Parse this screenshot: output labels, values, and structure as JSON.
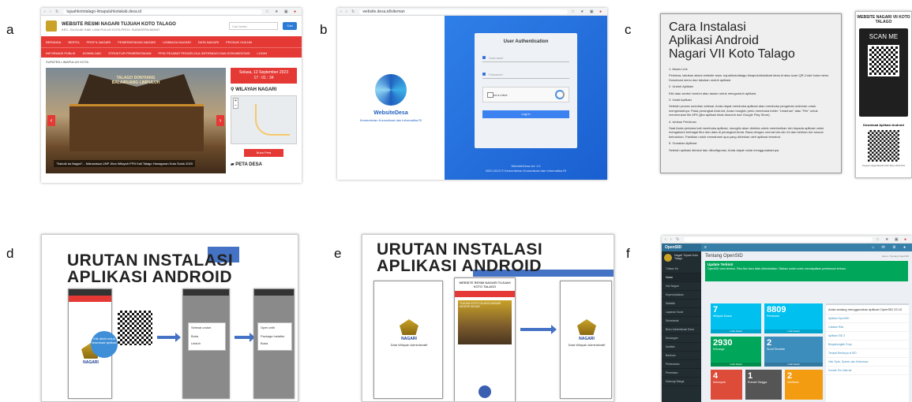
{
  "labels": {
    "a": "a",
    "b": "b",
    "c": "c",
    "d": "d",
    "e": "e",
    "f": "f"
  },
  "panel_a": {
    "url": "tujuahkototalago-limapuluhkotakab.desa.id",
    "site_title": "WEBSITE RESMI NAGARI TUJUAH KOTO TALAGO",
    "site_sub": "KEC. GUGUAK KAB. LIMA PULUH KOTA PROV. SUMATERA BARAT",
    "search_placeholder": "Cari berita",
    "search_button": "Cari",
    "nav1": [
      "BERANDA",
      "BERITA",
      "PROFIL NAGARI",
      "PEMERINTAHAN NAGARI",
      "LEMBAGA NAGARI",
      "DATA NAGARI",
      "PRODUK HUKUM"
    ],
    "nav2": [
      "INFORMASI PUBLIK",
      "DOWNLOAD",
      "STRUKTUR PEMERINTAHAN",
      "PPID PEJABAT PENGELOLA INFORMASI DAN DOKUMENTASI",
      "LOGIN"
    ],
    "breadcrumb": "SUPATEN LIMAPULUH KOTA",
    "photo_sign": "TALAGO DONYIANG BALAIRUANG LIMPULUH",
    "caption": "\"Sabuik ka Nagari\"... Mahasiswa UNP Jilna Wilayah PFN Kali Talago Hanagaran Kota Solok 2020",
    "date": "Selasa, 12 September 2023",
    "time": "17 : 01 : 34",
    "wilayah": "WILAYAH NAGARI",
    "buka_peta": "Buka Peta",
    "peta_desa": "PETA DESA"
  },
  "panel_b": {
    "url": "website.desa.id/siteman",
    "brand": "WebsiteDesa",
    "ministry": "Kementerian Komunikasi dan Informatika RI",
    "card_title": "User Authentication",
    "username_placeholder": "Username",
    "password_placeholder": "Password",
    "captcha_label": "I'm not a robot",
    "login_button": "Log In",
    "version": "WebsiteDesa ver 1.0",
    "copyright": "2020-2023 © Kementerian Komunikasi dan Informatika RI"
  },
  "panel_c": {
    "title_line1": "Cara Instalasi",
    "title_line2": "Aplikasi Android",
    "title_line3": "Nagari VII Koto Talago",
    "steps": [
      "1. Akses Link",
      "Pertama, lakukan akses website www. tujuahkototalago-limapuluhkotakab.desa.id atau scan QR-Code buka menu Download menu dan lakukan unduh aplikasi",
      "2. Unduh Aplikasi",
      "Klik atau sentuh tombol atau tautan untuk mengunduh aplikasi.",
      "3. Instal Aplikasi",
      "Setelah proses unduhan selesai, Anda dapat membuka aplikasi atau membuka pengelola unduhan untuk menginstalnya. Pada perangkat Android, Anda mungkin perlu membuka folder \"Unduhan\" atau \"File\" untuk menemukan file APK (jika aplikasi tidak diunduh dari Google Play Store).",
      "4. Izinkan Perizinan",
      "Saat Anda pertama kali membuka aplikasi, mungkin akan diminta untuk memberikan izin kepada aplikasi untuk mengakses berbagai fitur dan data di perangkat Anda. Baca dengan cermat izin-izin ini dan berikan izin sesuai kebutuhan. Pastikan untuk memahami apa yang diizinkan oleh aplikasi tersebut.",
      "5. Gunakan Aplikasi",
      "Setelah aplikasi diinstal dan dikonfigurasi, Anda dapat mulai menggunakannya."
    ],
    "poster_title": "WEBSITE NAGARI VII KOTO TALAGO",
    "scan_me": "SCAN ME",
    "download_label": "Download Aplikasi Android",
    "footer": "Program Nagari Mandiri UNP Tahun 2023 KKN"
  },
  "panel_d": {
    "title_line1": "URUTAN INSTALASI",
    "title_line2": "APLIKASI ANDROID",
    "bubble": "Klik disini untuk download aplikasi",
    "dialog1_title": "Selesai unduh",
    "dialog1_items": [
      "Buka",
      "Unduh"
    ],
    "dialog2_title": "Open with",
    "dialog2_items": [
      "Package installer",
      "Buka"
    ],
    "nagari": "NAGARI",
    "nagari_sub": "Data Wilayah Administratif"
  },
  "panel_e": {
    "title_line1": "URUTAN INSTALASI",
    "title_line2": "APLIKASI ANDROID",
    "phone_title": "WEBSITE RESMI NAGARI TUJUAH KOTO TALAGO",
    "phone_banner": "TUJUAH KOTO TALAGO NAGARI NEGERI SEGAR",
    "nagari": "NAGARI",
    "nagari_sub": "Data Wilayah Administratif"
  },
  "panel_f": {
    "app_name": "OpenSID",
    "sidebar_user": "Nagari Tujuah Koto Talago",
    "sidebar_items": [
      "Tulisan Ke",
      "Home",
      "Info Nagari",
      "Kependudukan",
      "Statistik",
      "Layanan Surat",
      "Sekretariat",
      "Buku Administrasi Desa",
      "Keuangan",
      "Analisis",
      "Bantuan",
      "Pertanahan",
      "Pemetaan",
      "Hubungi Warga"
    ],
    "page_title": "Tentang OpenSID",
    "breadcrumb": "Home / Tentang OpenSID",
    "alert_title": "Update Terkini!",
    "alert_text": "OpenSID versi terbaru. Fitur-fitur baru telah ditambahkan. Silakan unduh untuk mendapatkan pembaruan terbaru.",
    "stats": [
      {
        "n": "7",
        "l": "Wilayah Dusun",
        "c": "#00c0ef"
      },
      {
        "n": "8809",
        "l": "Penduduk",
        "c": "#00c0ef"
      },
      {
        "n": "2930",
        "l": "Keluarga",
        "c": "#00a65a"
      },
      {
        "n": "2",
        "l": "Surat Tercetak",
        "c": "#3c8dbc"
      },
      {
        "n": "4",
        "l": "Kelompok",
        "c": "#dd4b39"
      },
      {
        "n": "1",
        "l": "Rumah Tangga",
        "c": "#555"
      },
      {
        "n": "2",
        "l": "Verifikasi",
        "c": "#f39c12"
      }
    ],
    "more_info": "Lihat Detail",
    "news_header": "Anda sedang menggunakan aplikasi OpenSID 23.10",
    "news_items": [
      "Aplikasi OpenSID",
      "Catatan Rilis",
      "Aplikasi SID 3",
      "Bergabunglah Grup",
      "Tempat Bertanya di SID",
      "Hak Cipta, Syarat, dan Ketentuan",
      "Kontak Tim Internal"
    ]
  }
}
